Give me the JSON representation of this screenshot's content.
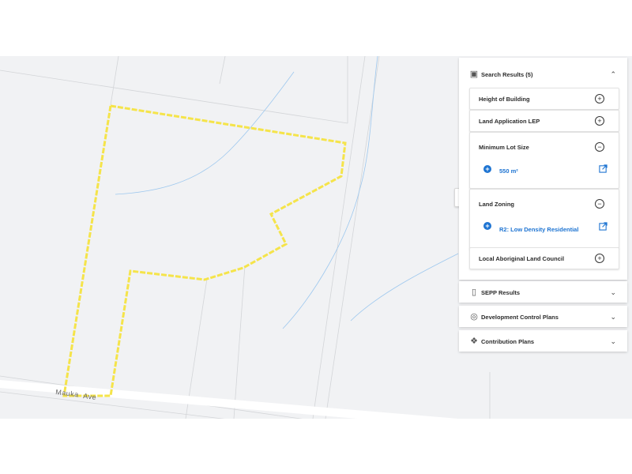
{
  "map": {
    "street": "Mauka",
    "street_suffix": "Ave",
    "boundary_color": "#f5e44a"
  },
  "panel": {
    "toggle_icon": "chevron-right-icon",
    "search_results": {
      "label": "Search Results (5)",
      "icon": "map-book-icon",
      "expanded": true,
      "cards": [
        {
          "title": "Height of Building",
          "state": "collapsed"
        },
        {
          "title": "Land Application LEP",
          "state": "collapsed"
        },
        {
          "title": "Minimum Lot Size",
          "state": "expanded",
          "value": "550 m²"
        },
        {
          "title": "Land Zoning",
          "state": "expanded",
          "value": "R2: Low Density Residential"
        },
        {
          "title": "Local Aboriginal Land Council",
          "state": "collapsed"
        }
      ]
    },
    "sepp": {
      "label": "SEPP Results",
      "icon": "document-icon"
    },
    "dcp": {
      "label": "Development Control Plans",
      "icon": "spiral-icon"
    },
    "contributions": {
      "label": "Contribution Plans",
      "icon": "puzzle-icon"
    }
  },
  "colors": {
    "accent": "#1e74d2",
    "map_bg": "#f1f2f4",
    "boundary": "#f5e44a",
    "water": "#9ec8ee"
  }
}
